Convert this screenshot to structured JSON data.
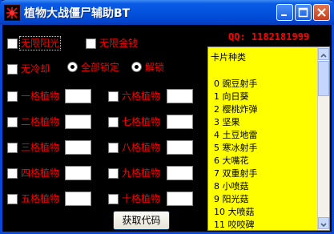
{
  "window": {
    "title": "植物大战僵尸辅助BT"
  },
  "qq": "QQ: 1182181999",
  "options": {
    "unlimited_sun": "无限阳光",
    "unlimited_money": "无限金钱",
    "no_cooldown": "无冷却",
    "lock_all": "全部锁定",
    "unlock": "解锁"
  },
  "slots": [
    {
      "label": "一格植物",
      "value": ""
    },
    {
      "label": "二格植物",
      "value": ""
    },
    {
      "label": "三格植物",
      "value": ""
    },
    {
      "label": "四格植物",
      "value": ""
    },
    {
      "label": "五格植物",
      "value": ""
    },
    {
      "label": "六格植物",
      "value": ""
    },
    {
      "label": "七格植物",
      "value": ""
    },
    {
      "label": "八格植物",
      "value": ""
    },
    {
      "label": "九格植物",
      "value": ""
    },
    {
      "label": "十格植物",
      "value": ""
    }
  ],
  "card_list": {
    "header": "卡片种类",
    "items": [
      "0  豌豆射手",
      "1  向日葵",
      "2  樱桃炸弹",
      "3  坚果",
      "4  土豆地雷",
      "5  寒冰射手",
      "6  大嘴花",
      "7  双重射手",
      "8  小喷菇",
      "9  阳光菇",
      "10 大喷菇",
      "11 咬咬碑"
    ]
  },
  "get_code_label": "获取代码",
  "colors": {
    "label": "#ff0000",
    "list_bg": "#ffff00",
    "background": "#000000"
  }
}
